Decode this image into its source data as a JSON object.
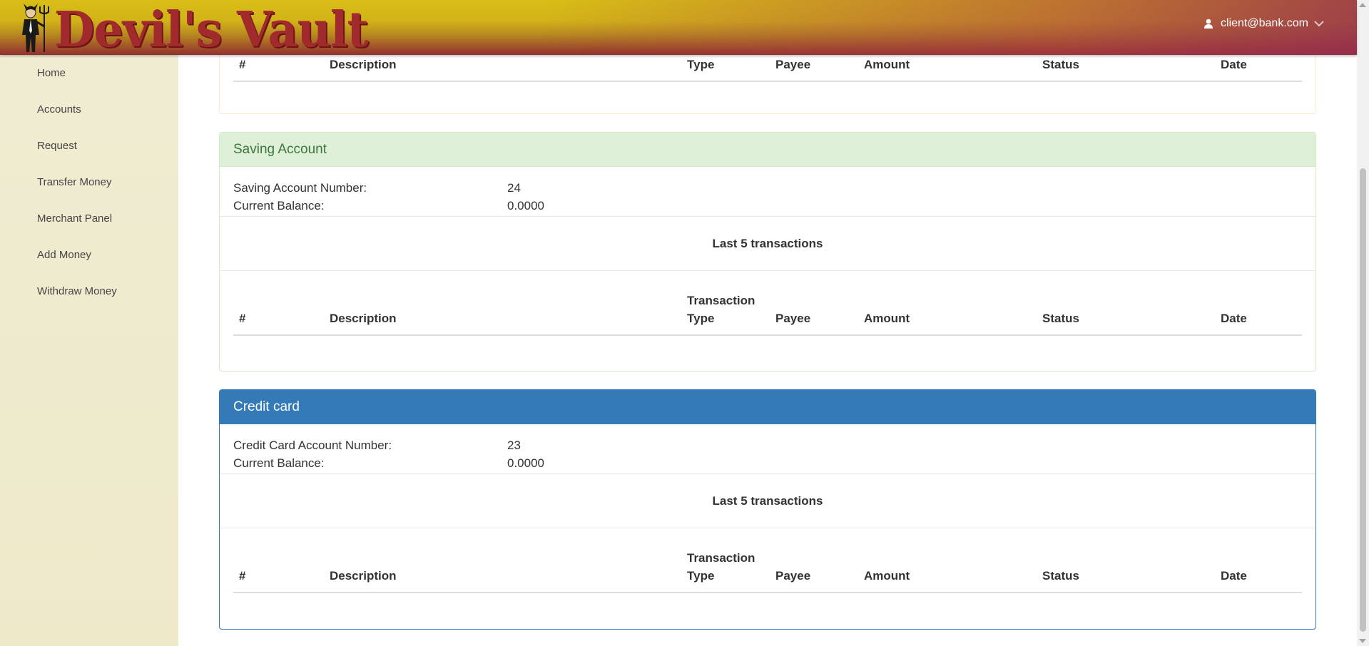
{
  "header": {
    "brand": "Devil's Vault",
    "user_email": "client@bank.com"
  },
  "sidebar": {
    "items": [
      {
        "label": "Home"
      },
      {
        "label": "Accounts"
      },
      {
        "label": "Request"
      },
      {
        "label": "Transfer Money"
      },
      {
        "label": "Merchant Panel"
      },
      {
        "label": "Add Money"
      },
      {
        "label": "Withdraw Money"
      }
    ]
  },
  "current_account": {
    "columns": [
      "#",
      "Description",
      "Type",
      "Payee",
      "Amount",
      "Status",
      "Date"
    ]
  },
  "saving_account": {
    "heading": "Saving Account",
    "number_label": "Saving Account Number:",
    "number_value": "24",
    "balance_label": "Current Balance:",
    "balance_value": "0.0000",
    "last_title": "Last 5 transactions",
    "columns": {
      "num": "#",
      "description": "Description",
      "type_line1": "Transaction",
      "type_line2": "Type",
      "payee": "Payee",
      "amount": "Amount",
      "status": "Status",
      "date": "Date"
    }
  },
  "credit_card": {
    "heading": "Credit card",
    "number_label": "Credit Card Account Number:",
    "number_value": "23",
    "balance_label": "Current Balance:",
    "balance_value": "0.0000",
    "last_title": "Last 5 transactions",
    "columns": {
      "num": "#",
      "description": "Description",
      "type_line1": "Transaction",
      "type_line2": "Type",
      "payee": "Payee",
      "amount": "Amount",
      "status": "Status",
      "date": "Date"
    }
  },
  "colors": {
    "saving_heading_bg": "#dff0d8",
    "saving_heading_text": "#3c763d",
    "credit_heading_bg": "#337ab7",
    "brand_red": "#a02a2c",
    "sidebar_bg": "#efebcd"
  }
}
